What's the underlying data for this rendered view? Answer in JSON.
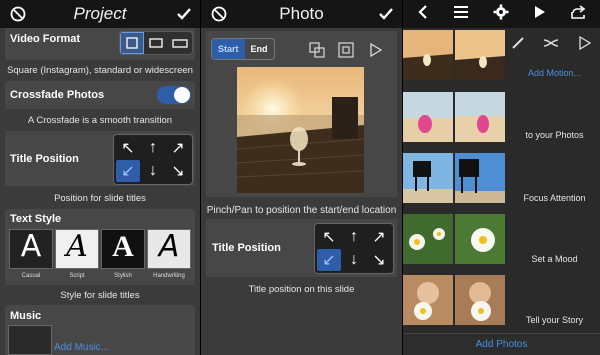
{
  "project": {
    "title": "Project",
    "video_format": {
      "label": "Video Format",
      "caption": "Square (Instagram), standard or widescreen",
      "options": [
        "square",
        "standard",
        "widescreen"
      ],
      "selected": "square"
    },
    "crossfade": {
      "label": "Crossfade Photos",
      "caption": "A Crossfade is a smooth transition",
      "enabled": true
    },
    "title_position": {
      "label": "Title Position",
      "caption": "Position for slide titles"
    },
    "text_style": {
      "label": "Text Style",
      "caption": "Style for slide titles",
      "styles": [
        "Casual",
        "Script",
        "Stylish",
        "Handwriting"
      ]
    },
    "music": {
      "label": "Music",
      "add_label": "Add Music..."
    }
  },
  "photo": {
    "title": "Photo",
    "start_label": "Start",
    "end_label": "End",
    "pinch_caption": "Pinch/Pan to position the start/end location",
    "title_position": {
      "label": "Title Position",
      "caption": "Title position on this slide"
    }
  },
  "slides": {
    "rows": [
      {
        "label": "Add Motion..."
      },
      {
        "label": "to your Photos"
      },
      {
        "label": "Focus Attention"
      },
      {
        "label": "Set a Mood"
      },
      {
        "label": "Tell your Story"
      }
    ],
    "add_photos_label": "Add Photos"
  },
  "colors": {
    "accent": "#4a90e2",
    "panel_bg": "#3b3b3b",
    "section_bg": "#474747",
    "topbar_bg": "#151515"
  }
}
